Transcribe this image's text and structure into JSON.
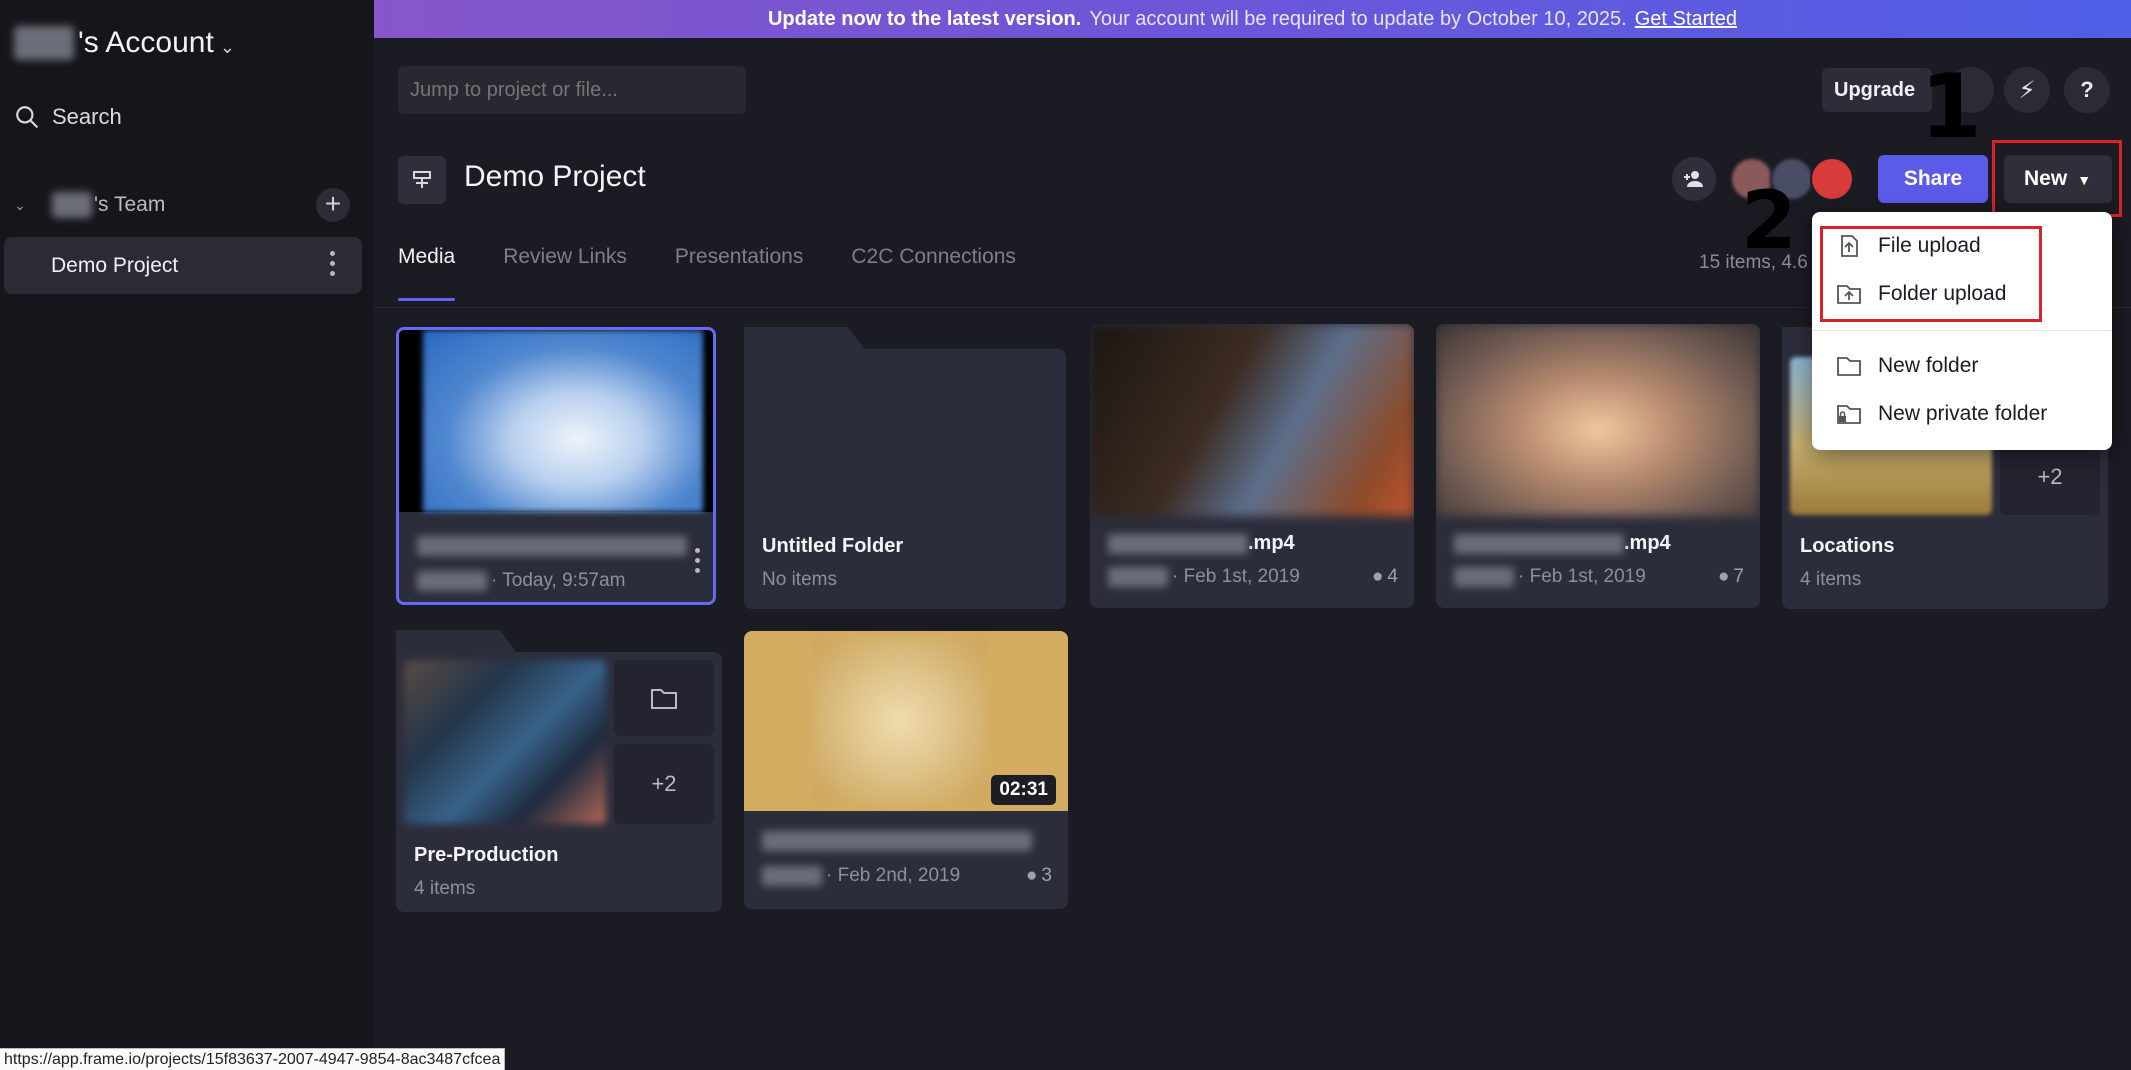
{
  "sidebar": {
    "account_suffix": "'s Account",
    "search_label": "Search",
    "team_suffix": "'s Team",
    "project_item": "Demo Project"
  },
  "banner": {
    "bold": "Update now to the latest version.",
    "text": "Your account will be required to update by October 10, 2025.",
    "link": "Get Started"
  },
  "topbar": {
    "jump_placeholder": "Jump to project or file...",
    "upgrade": "Upgrade",
    "bolt_icon": "⚡",
    "help_icon": "?"
  },
  "project": {
    "title": "Demo Project",
    "share": "Share",
    "new": "New"
  },
  "tabs": [
    "Media",
    "Review Links",
    "Presentations",
    "C2C Connections"
  ],
  "summary": "15 items, 4.6",
  "cards": {
    "c1": {
      "meta": "· Today, 9:57am"
    },
    "c2": {
      "title": "Untitled Folder",
      "meta": "No items"
    },
    "c3": {
      "title_suffix": ".mp4",
      "meta": "· Feb 1st, 2019",
      "comments": "4"
    },
    "c4": {
      "title_suffix": ".mp4",
      "meta": "· Feb 1st, 2019",
      "comments": "7"
    },
    "c5": {
      "title": "Locations",
      "meta": "4 items",
      "plus": "+2"
    },
    "c6": {
      "title": "Pre-Production",
      "meta": "4 items",
      "plus": "+2"
    },
    "c7": {
      "duration": "02:31",
      "meta": "· Feb 2nd, 2019",
      "comments": "3"
    }
  },
  "menu": {
    "file_upload": "File upload",
    "folder_upload": "Folder upload",
    "new_folder": "New folder",
    "new_private_folder": "New private folder"
  },
  "annotations": {
    "badge_1": "1",
    "badge_2": "2",
    "color": "#d9222a"
  },
  "statusbar": "https://app.frame.io/projects/15f83637-2007-4947-9854-8ac3487cfcea",
  "colors": {
    "accent": "#5b5be8",
    "background": "#1a1b23",
    "sidebar": "#15161b",
    "card": "#2c2d3b"
  }
}
